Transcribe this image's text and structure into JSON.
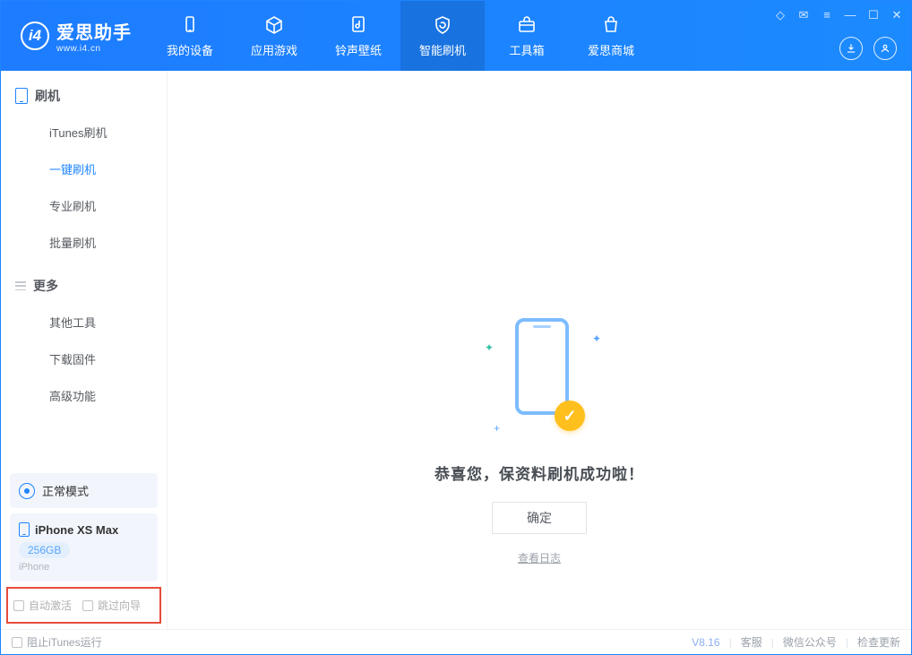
{
  "app": {
    "title": "爱思助手",
    "subtitle": "www.i4.cn"
  },
  "tabs": {
    "device": "我的设备",
    "apps": "应用游戏",
    "ring": "铃声壁纸",
    "flash": "智能刷机",
    "tools": "工具箱",
    "store": "爱思商城"
  },
  "sidebar": {
    "group_flash": "刷机",
    "itunes_flash": "iTunes刷机",
    "one_click": "一键刷机",
    "pro_flash": "专业刷机",
    "batch_flash": "批量刷机",
    "group_more": "更多",
    "other_tools": "其他工具",
    "download_fw": "下载固件",
    "advanced": "高级功能"
  },
  "mode": {
    "label": "正常模式"
  },
  "device": {
    "name": "iPhone XS Max",
    "storage": "256GB",
    "type": "iPhone"
  },
  "checks": {
    "auto_activate": "自动激活",
    "skip_guide": "跳过向导"
  },
  "result": {
    "message": "恭喜您，保资料刷机成功啦！",
    "ok": "确定",
    "log": "查看日志"
  },
  "footer": {
    "block_itunes": "阻止iTunes运行",
    "version": "V8.16",
    "support": "客服",
    "wechat": "微信公众号",
    "update": "检查更新"
  }
}
